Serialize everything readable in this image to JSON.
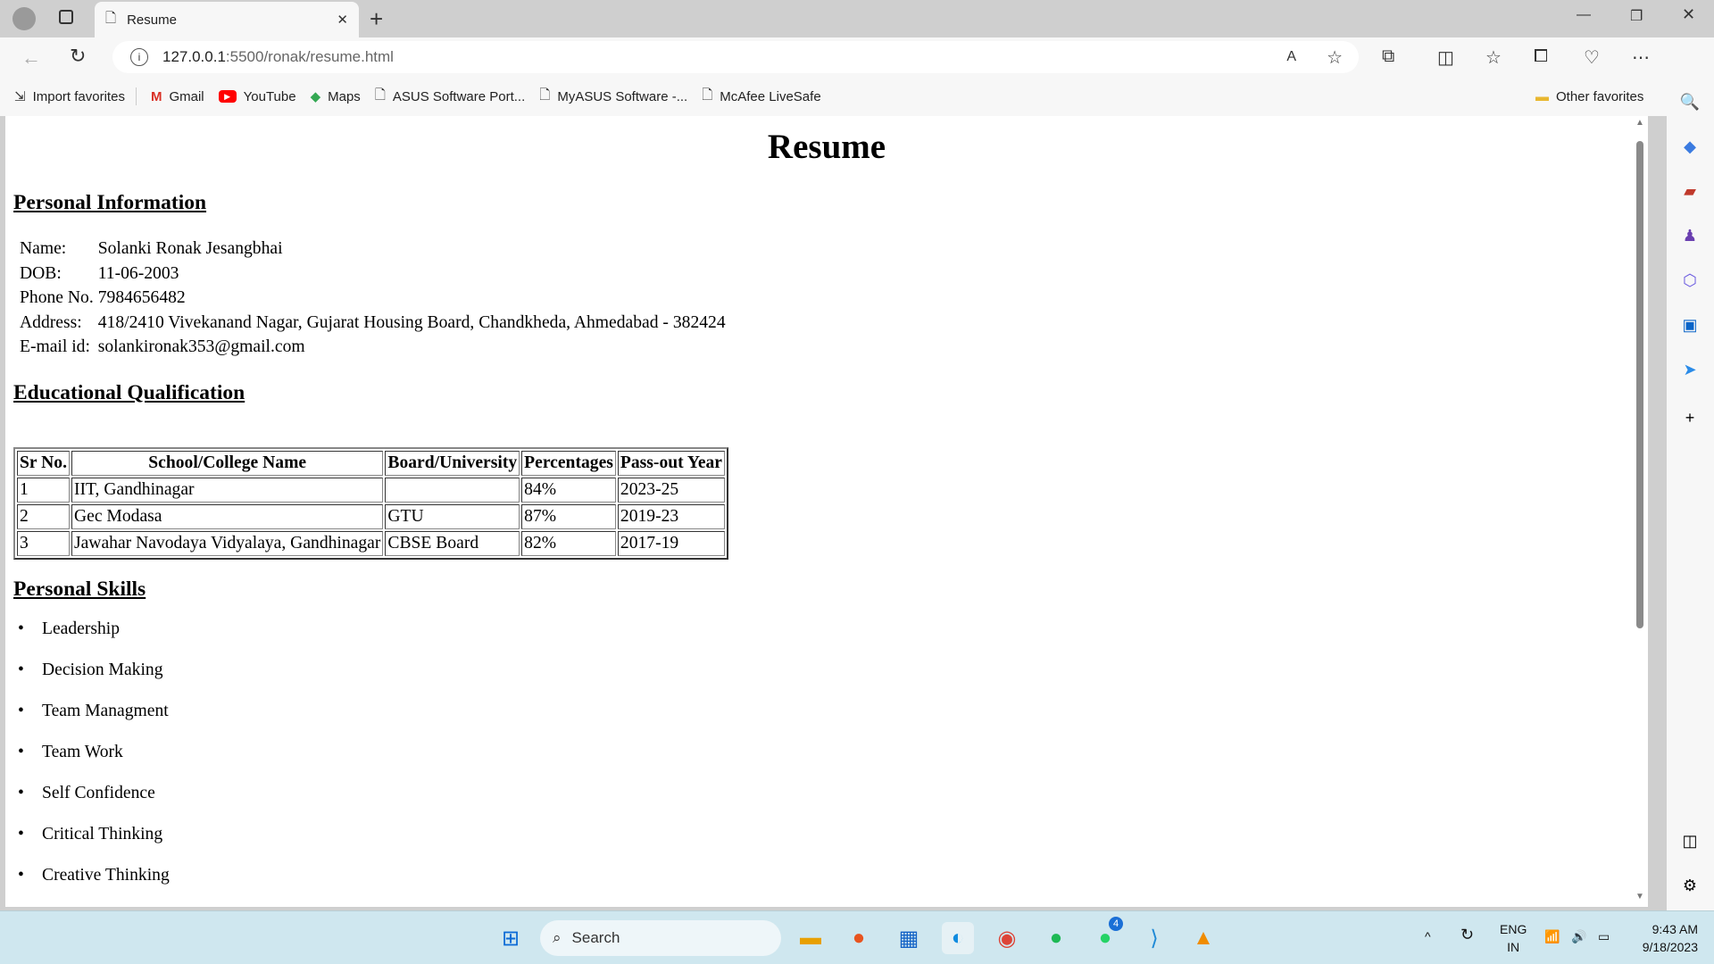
{
  "browser": {
    "tab_title": "Resume",
    "url_host": "127.0.0.1",
    "url_path": ":5500/ronak/resume.html",
    "bookmarks": [
      "Import favorites",
      "Gmail",
      "YouTube",
      "Maps",
      "ASUS Software Port...",
      "MyASUS Software -...",
      "McAfee LiveSafe"
    ],
    "other_favorites": "Other favorites"
  },
  "page": {
    "title": "Resume",
    "personal_heading": "Personal Information",
    "personal": [
      {
        "label": "Name:",
        "value": "Solanki Ronak Jesangbhai"
      },
      {
        "label": "DOB:",
        "value": "11-06-2003"
      },
      {
        "label": "Phone No.",
        "value": "7984656482"
      },
      {
        "label": "Address:",
        "value": "418/2410 Vivekanand Nagar, Gujarat Housing Board, Chandkheda, Ahmedabad - 382424"
      },
      {
        "label": "E-mail id:",
        "value": "solankironak353@gmail.com"
      }
    ],
    "education_heading": "Educational Qualification",
    "education_columns": [
      "Sr No.",
      "School/College Name",
      "Board/University",
      "Percentages",
      "Pass-out Year"
    ],
    "education_rows": [
      [
        "1",
        "IIT, Gandhinagar",
        "",
        "84%",
        "2023-25"
      ],
      [
        "2",
        "Gec Modasa",
        "GTU",
        "87%",
        "2019-23"
      ],
      [
        "3",
        "Jawahar Navodaya Vidyalaya, Gandhinagar",
        "CBSE Board",
        "82%",
        "2017-19"
      ]
    ],
    "skills_heading": "Personal Skills",
    "skills": [
      "Leadership",
      "Decision Making",
      "Team Managment",
      "Team Work",
      "Self Confidence",
      "Critical Thinking",
      "Creative Thinking"
    ]
  },
  "taskbar": {
    "search_placeholder": "Search",
    "whatsapp_badge": "4",
    "lang_line1": "ENG",
    "lang_line2": "IN",
    "time": "9:43 AM",
    "date": "9/18/2023"
  }
}
